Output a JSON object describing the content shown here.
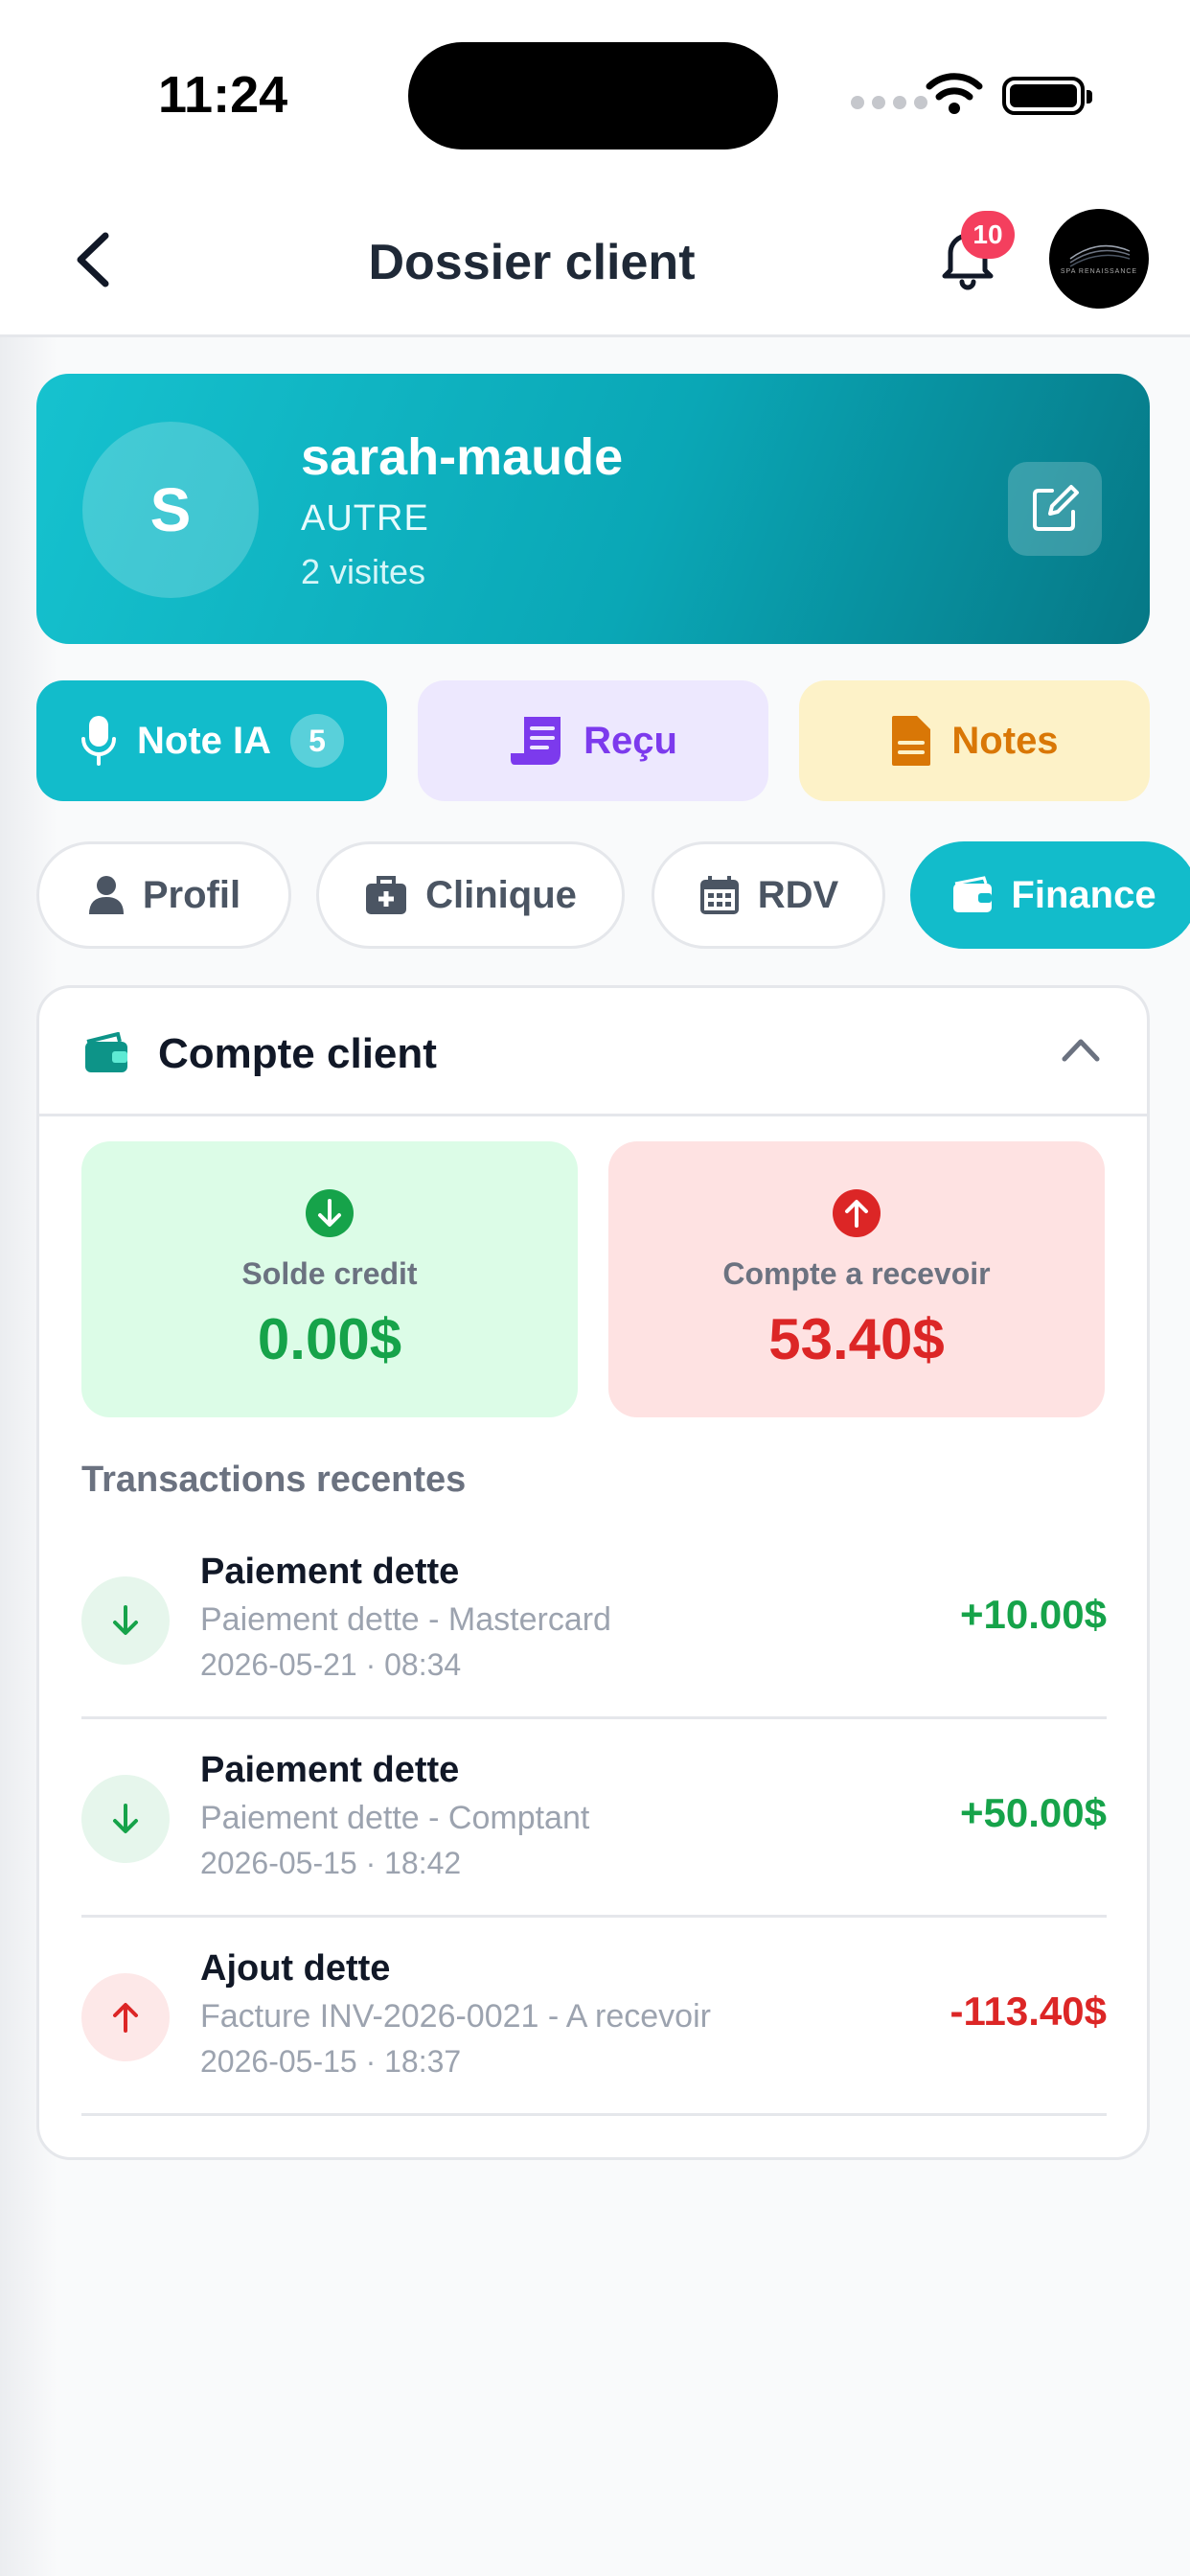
{
  "status_bar": {
    "time": "11:24"
  },
  "header": {
    "title": "Dossier client",
    "notification_count": "10",
    "logo_text": "SPA RENAISSANCE"
  },
  "client": {
    "initial": "S",
    "name": "sarah-maude",
    "type": "AUTRE",
    "visits": "2 visites"
  },
  "actions": [
    {
      "label": "Note IA",
      "count": "5",
      "icon": "microphone-icon"
    },
    {
      "label": "Reçu",
      "icon": "receipt-icon"
    },
    {
      "label": "Notes",
      "icon": "document-icon"
    }
  ],
  "tabs": [
    {
      "label": "Profil",
      "icon": "person-icon"
    },
    {
      "label": "Clinique",
      "icon": "medical-kit-icon"
    },
    {
      "label": "RDV",
      "icon": "calendar-icon"
    },
    {
      "label": "Finance",
      "icon": "wallet-icon",
      "active": true
    }
  ],
  "account": {
    "title": "Compte client",
    "credit": {
      "label": "Solde credit",
      "value": "0.00$"
    },
    "receivable": {
      "label": "Compte a recevoir",
      "value": "53.40$"
    },
    "transactions_title": "Transactions recentes",
    "transactions": [
      {
        "title": "Paiement dette",
        "description": "Paiement dette - Mastercard",
        "date": "2026-05-21 · 08:34",
        "amount": "+10.00$",
        "direction": "in"
      },
      {
        "title": "Paiement dette",
        "description": "Paiement dette - Comptant",
        "date": "2026-05-15 · 18:42",
        "amount": "+50.00$",
        "direction": "in"
      },
      {
        "title": "Ajout dette",
        "description": "Facture INV-2026-0021 - A recevoir",
        "date": "2026-05-15 · 18:37",
        "amount": "-113.40$",
        "direction": "out"
      }
    ]
  },
  "colors": {
    "accent": "#12bccb",
    "positive": "#16a34a",
    "negative": "#dc2626",
    "badge": "#f43f5e"
  }
}
